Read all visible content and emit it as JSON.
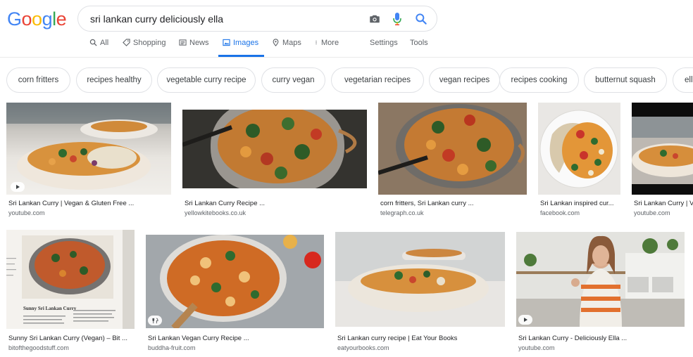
{
  "logo": {
    "text": [
      "G",
      "o",
      "o",
      "g",
      "l",
      "e"
    ]
  },
  "search": {
    "query": "sri lankan curry deliciously ella"
  },
  "tabs": [
    {
      "label": "All",
      "icon": "search-icon"
    },
    {
      "label": "Shopping",
      "icon": "tag-icon"
    },
    {
      "label": "News",
      "icon": "news-icon"
    },
    {
      "label": "Images",
      "icon": "image-icon",
      "active": true
    },
    {
      "label": "Maps",
      "icon": "map-pin-icon"
    },
    {
      "label": "More",
      "icon": "more-vert-icon"
    },
    {
      "label": "Settings"
    },
    {
      "label": "Tools"
    }
  ],
  "chips": [
    "corn fritters",
    "recipes healthy",
    "vegetable curry recipe",
    "curry vegan",
    "vegetarian recipes",
    "vegan recipes",
    "recipes cooking",
    "butternut squash",
    "ella"
  ],
  "results": [
    {
      "title": "Sri Lankan Curry | Vegan & Gluten Free ...",
      "source": "youtube.com",
      "badge": "play-icon"
    },
    {
      "title": "Sri Lankan Curry Recipe ...",
      "source": "yellowkitebooks.co.uk"
    },
    {
      "title": "corn fritters, Sri Lankan curry ...",
      "source": "telegraph.co.uk"
    },
    {
      "title": "Sri Lankan inspired cur...",
      "source": "facebook.com"
    },
    {
      "title": "Sri Lankan Curry | V",
      "source": "youtube.com"
    },
    {
      "title": "Sunny Sri Lankan Curry (Vegan) – Bit ...",
      "source": "bitofthegoodstuff.com"
    },
    {
      "title": "Sri Lankan Vegan Curry Recipe ...",
      "source": "buddha-fruit.com",
      "badge": "recipe-icon"
    },
    {
      "title": "Sri Lankan curry recipe | Eat Your Books",
      "source": "eatyourbooks.com"
    },
    {
      "title": "Sri Lankan Curry - Deliciously Ella ...",
      "source": "youtube.com",
      "badge": "play-icon"
    }
  ],
  "colors": {
    "accent": "#1a73e8",
    "logo_blue": "#4285f4",
    "logo_red": "#ea4335",
    "logo_yellow": "#fbbc05",
    "logo_green": "#34a853"
  }
}
